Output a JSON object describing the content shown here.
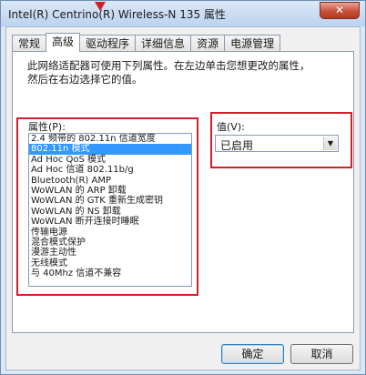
{
  "window": {
    "title": "Intel(R) Centrino(R) Wireless-N 135 属性",
    "close_label": "✕"
  },
  "tabs": [
    {
      "label": "常规"
    },
    {
      "label": "高级"
    },
    {
      "label": "驱动程序"
    },
    {
      "label": "详细信息"
    },
    {
      "label": "资源"
    },
    {
      "label": "电源管理"
    }
  ],
  "active_tab": "高级",
  "description_line1": "此网络适配器可使用下列属性。在左边单击您想更改的属性，",
  "description_line2": "然后在右边选择它的值。",
  "property": {
    "label": "属性(P):",
    "items": [
      "2.4 频带的 802.11n 信道宽度",
      "802.11n 模式",
      "Ad Hoc QoS 模式",
      "Ad Hoc 信道 802.11b/g",
      "Bluetooth(R) AMP",
      "WoWLAN 的 ARP 卸载",
      "WoWLAN 的 GTK 重新生成密钥",
      "WoWLAN 的 NS 卸载",
      "WoWLAN 断开连接时睡眠",
      "传输电源",
      "混合模式保护",
      "漫游主动性",
      "无线模式",
      "与 40Mhz 信道不兼容"
    ],
    "selected_index": 1
  },
  "value": {
    "label": "值(V):",
    "selected": "已启用"
  },
  "buttons": {
    "ok": "确定",
    "cancel": "取消"
  },
  "colors": {
    "highlight": "#d21f2b",
    "selection": "#3399ff"
  }
}
